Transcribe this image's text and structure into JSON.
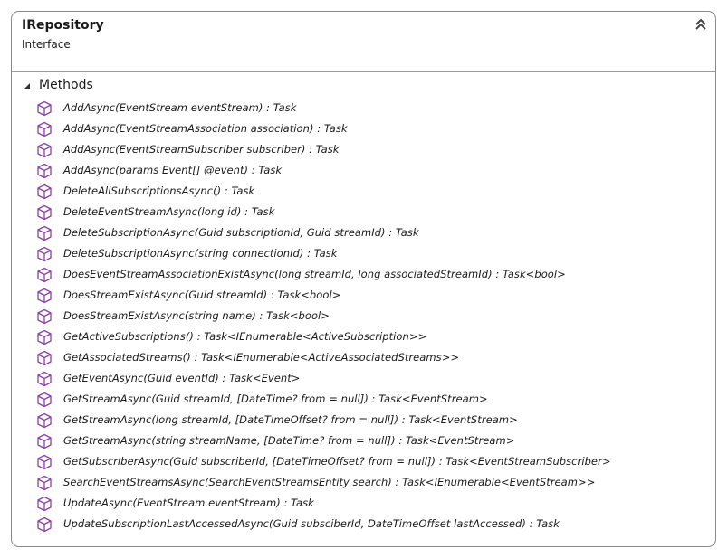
{
  "type_box": {
    "name": "IRepository",
    "kind": "Interface",
    "collapse_icon": "double-chevron-up-icon"
  },
  "section": {
    "label": "Methods",
    "toggle_icon": "triangle-expanded-icon",
    "member_icon": "method-cube-icon",
    "icon_color": "#8e3fa8"
  },
  "methods": [
    "AddAsync(EventStream eventStream) : Task",
    "AddAsync(EventStreamAssociation association) : Task",
    "AddAsync(EventStreamSubscriber subscriber) : Task",
    "AddAsync(params Event[] @event) : Task",
    "DeleteAllSubscriptionsAsync() : Task",
    "DeleteEventStreamAsync(long id) : Task",
    "DeleteSubscriptionAsync(Guid subscriptionId, Guid streamId) : Task",
    "DeleteSubscriptionAsync(string connectionId) : Task",
    "DoesEventStreamAssociationExistAsync(long streamId, long associatedStreamId) : Task<bool>",
    "DoesStreamExistAsync(Guid streamId) : Task<bool>",
    "DoesStreamExistAsync(string name) : Task<bool>",
    "GetActiveSubscriptions() : Task<IEnumerable<ActiveSubscription>>",
    "GetAssociatedStreams() : Task<IEnumerable<ActiveAssociatedStreams>>",
    "GetEventAsync(Guid eventId) : Task<Event>",
    "GetStreamAsync(Guid streamId, [DateTime? from = null]) : Task<EventStream>",
    "GetStreamAsync(long streamId, [DateTimeOffset? from = null]) : Task<EventStream>",
    "GetStreamAsync(string streamName, [DateTime? from = null]) : Task<EventStream>",
    "GetSubscriberAsync(Guid subscriberId, [DateTimeOffset? from = null]) : Task<EventStreamSubscriber>",
    "SearchEventStreamsAsync(SearchEventStreamsEntity search) : Task<IEnumerable<EventStream>>",
    "UpdateAsync(EventStream eventStream) : Task",
    "UpdateSubscriptionLastAccessedAsync(Guid subsciberId, DateTimeOffset lastAccessed) : Task"
  ]
}
